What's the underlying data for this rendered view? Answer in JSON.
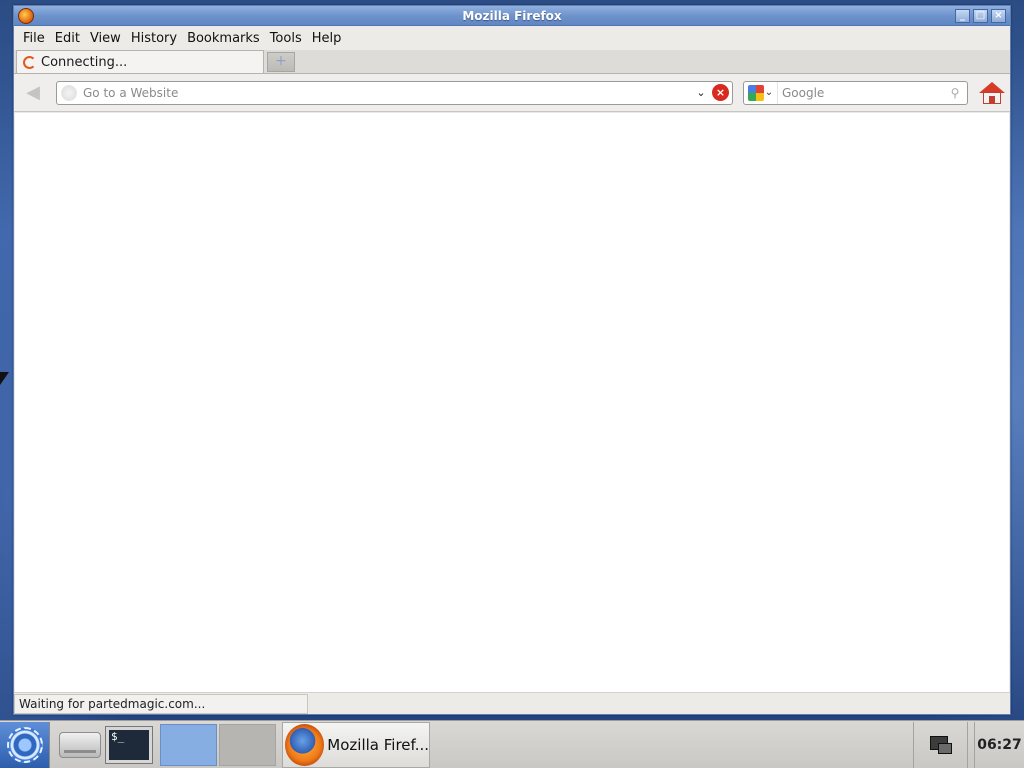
{
  "window": {
    "title": "Mozilla Firefox",
    "controls": {
      "minimize": "_",
      "maximize": "□",
      "close": "×"
    }
  },
  "menu": [
    "File",
    "Edit",
    "View",
    "History",
    "Bookmarks",
    "Tools",
    "Help"
  ],
  "tab": {
    "label": "Connecting...",
    "new_tab_symbol": "+"
  },
  "navbar": {
    "back_symbol": "◀",
    "url_placeholder": "Go to a Website",
    "url_value": "",
    "dropmarker": "⌄",
    "stop_symbol": "×",
    "search_placeholder": "Google",
    "search_engine_caret": "⌄",
    "search_go_symbol": "⚲"
  },
  "status": {
    "text": "Waiting for partedmagic.com..."
  },
  "taskbar": {
    "terminal_prompt": "$_",
    "task_label": "Mozilla Firef...",
    "clock": "06:27"
  },
  "colors": {
    "titlebar": "#6f93cc",
    "stop": "#d92a1f",
    "home": "#d83a28",
    "desktop": "#2e5193"
  },
  "icons": {
    "app": "firefox-icon",
    "site": "site-identity-icon",
    "home": "home-icon",
    "launcher": "launcher-gear-icon",
    "drive": "hard-drive-icon",
    "terminal": "terminal-icon",
    "network": "network-icon"
  }
}
